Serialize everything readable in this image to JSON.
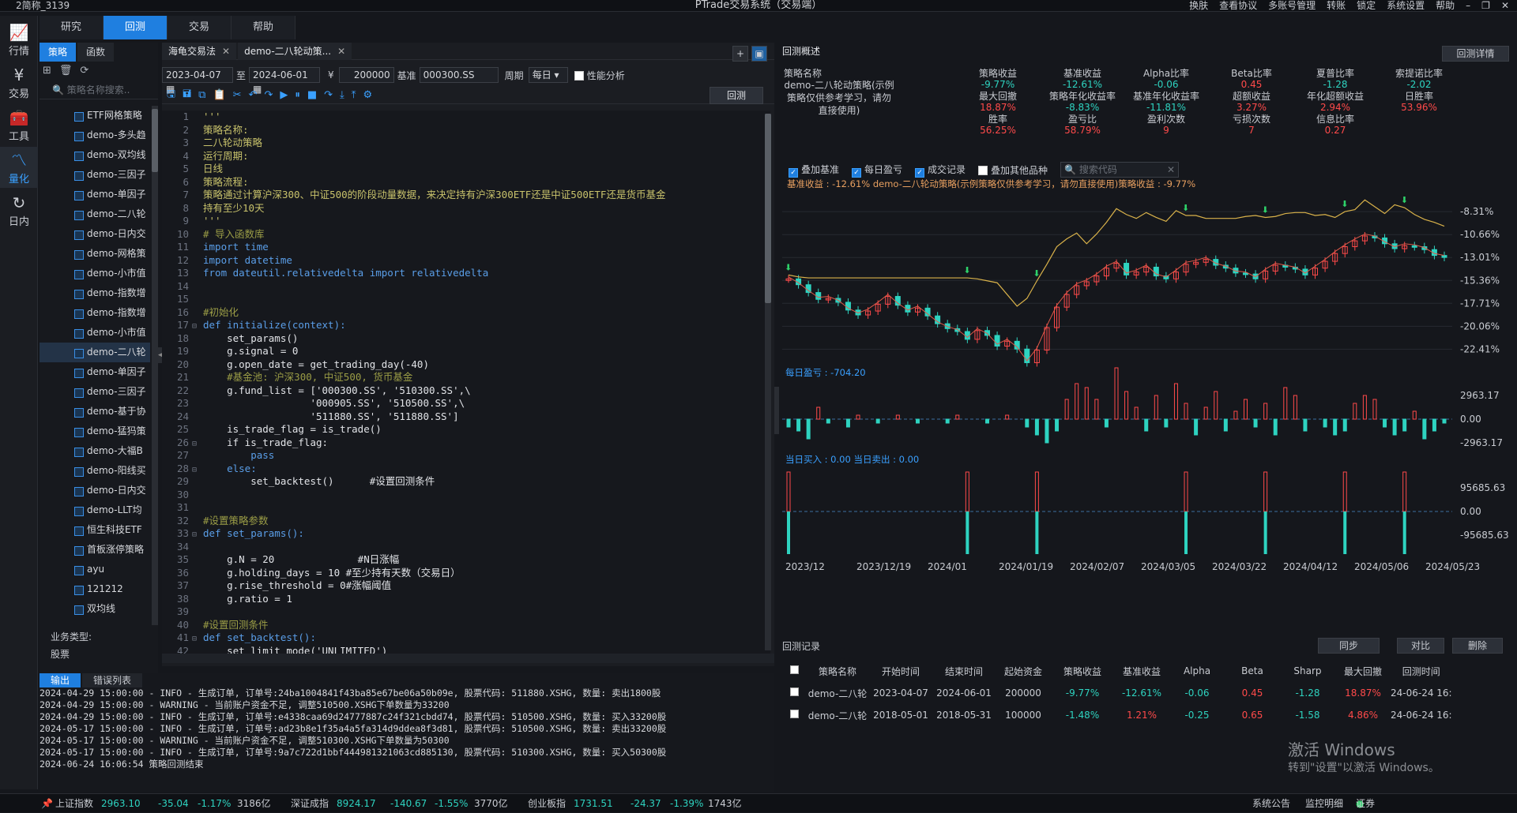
{
  "titlebar": {
    "user": "2简称_3139",
    "app": "PTrade交易系统（交易端）",
    "tools": [
      "换肤",
      "查看协议",
      "多账号管理",
      "转账",
      "锁定",
      "系统设置",
      "帮助"
    ]
  },
  "menu": [
    "研究",
    "回测",
    "交易",
    "帮助"
  ],
  "leftnav": [
    "行情",
    "交易",
    "工具",
    "量化",
    "日内"
  ],
  "strategy": {
    "tabs": [
      "策略",
      "函数"
    ],
    "search_placeholder": "策略名称搜索..",
    "items": [
      "ETF网格策略",
      "demo-多头趋",
      "demo-双均线",
      "demo-三因子",
      "demo-单因子",
      "demo-二八轮",
      "demo-日内交",
      "demo-网格策",
      "demo-小市值",
      "demo-指数增",
      "demo-指数增",
      "demo-小市值",
      "demo-二八轮",
      "demo-单因子",
      "demo-三因子",
      "demo-基于协",
      "demo-猛犸策",
      "demo-大福B",
      "demo-阳线买",
      "demo-日内交",
      "demo-LLT均",
      "恒生科技ETF",
      "首板涨停策略",
      "ayu",
      "121212",
      "双均线"
    ],
    "selected_index": 12,
    "biz_label": "业务类型:",
    "biz_value": "股票"
  },
  "editor": {
    "tabs": [
      "海龟交易法",
      "demo-二八轮动策..."
    ],
    "start": "2023-04-07",
    "to": "至",
    "end": "2024-06-01",
    "currency": "¥",
    "capital": "200000",
    "bench_label": "基准",
    "bench": "000300.SS",
    "period_label": "周期",
    "period": "每日",
    "perf": "性能分析",
    "backtest_btn": "回测"
  },
  "code": [
    [
      "1",
      "",
      "'''",
      "c"
    ],
    [
      "2",
      "",
      "策略名称:",
      "c"
    ],
    [
      "3",
      "",
      "二八轮动策略",
      "c"
    ],
    [
      "4",
      "",
      "运行周期:",
      "c"
    ],
    [
      "5",
      "",
      "日线",
      "c"
    ],
    [
      "6",
      "",
      "策略流程:",
      "c"
    ],
    [
      "7",
      "",
      "策略通过计算沪深300、中证500的阶段动量数据，来决定持有沪深300ETF还是中证500ETF还是货币基金",
      "c"
    ],
    [
      "8",
      "",
      "持有至少10天",
      "c"
    ],
    [
      "9",
      "",
      "'''",
      "c"
    ],
    [
      "10",
      "",
      "# 导入函数库",
      "cm"
    ],
    [
      "11",
      "",
      "import time",
      "k"
    ],
    [
      "12",
      "",
      "import datetime",
      "k"
    ],
    [
      "13",
      "",
      "from dateutil.relativedelta import relativedelta",
      "k"
    ],
    [
      "14",
      "",
      "",
      "d"
    ],
    [
      "15",
      "",
      "",
      "d"
    ],
    [
      "16",
      "",
      "#初始化",
      "cm"
    ],
    [
      "17",
      "⊟",
      "def initialize(context):",
      "k"
    ],
    [
      "18",
      "",
      "    set_params()",
      "d"
    ],
    [
      "19",
      "",
      "    g.signal = 0",
      "d"
    ],
    [
      "20",
      "",
      "    g.open_date = get_trading_day(-40)",
      "d"
    ],
    [
      "21",
      "",
      "    #基金池: 沪深300, 中证500, 货币基金",
      "cm"
    ],
    [
      "22",
      "",
      "    g.fund_list = ['000300.SS', '510300.SS',\\",
      "d"
    ],
    [
      "23",
      "",
      "                  '000905.SS', '510500.SS',\\",
      "d"
    ],
    [
      "24",
      "",
      "                  '511880.SS', '511880.SS']",
      "d"
    ],
    [
      "25",
      "",
      "    is_trade_flag = is_trade()",
      "d"
    ],
    [
      "26",
      "⊟",
      "    if is_trade_flag:",
      "d"
    ],
    [
      "27",
      "",
      "        pass",
      "k"
    ],
    [
      "28",
      "⊟",
      "    else:",
      "k"
    ],
    [
      "29",
      "",
      "        set_backtest()      #设置回测条件",
      "d"
    ],
    [
      "30",
      "",
      "",
      "d"
    ],
    [
      "31",
      "",
      "",
      "d"
    ],
    [
      "32",
      "",
      "#设置策略参数",
      "cm"
    ],
    [
      "33",
      "⊟",
      "def set_params():",
      "k"
    ],
    [
      "34",
      "",
      "",
      "d"
    ],
    [
      "35",
      "",
      "    g.N = 20              #N日涨幅",
      "d"
    ],
    [
      "36",
      "",
      "    g.holding_days = 10 #至少持有天数（交易日）",
      "d"
    ],
    [
      "37",
      "",
      "    g.rise_threshold = 0#涨幅阈值",
      "d"
    ],
    [
      "38",
      "",
      "    g.ratio = 1",
      "d"
    ],
    [
      "39",
      "",
      "",
      "d"
    ],
    [
      "40",
      "",
      "#设置回测条件",
      "cm"
    ],
    [
      "41",
      "⊟",
      "def set_backtest():",
      "k"
    ],
    [
      "42",
      "",
      "    set_limit_mode('UNLIMITED')",
      "d"
    ]
  ],
  "output": {
    "tabs": [
      "输出",
      "错误列表"
    ],
    "lines": [
      "2024-04-29 15:00:00 - INFO - 生成订单, 订单号:24ba1004841f43ba85e67be06a50b09e, 股票代码: 511880.XSHG, 数量: 卖出1800股",
      "2024-04-29 15:00:00 - WARNING - 当前账户资金不足, 调整510500.XSHG下单数量为33200",
      "2024-04-29 15:00:00 - INFO - 生成订单, 订单号:e4338caa69d24777887c24f321cbdd74, 股票代码: 510500.XSHG, 数量: 买入33200股",
      "2024-05-17 15:00:00 - INFO - 生成订单, 订单号:ad23b8e1f35a4a5fa314d9ddea8f3d81, 股票代码: 510500.XSHG, 数量: 卖出33200股",
      "2024-05-17 15:00:00 - WARNING - 当前账户资金不足, 调整510300.XSHG下单数量为50300",
      "2024-05-17 15:00:00 - INFO - 生成订单, 订单号:9a7c722d1bbf444981321063cd885130, 股票代码: 510300.XSHG, 数量: 买入50300股",
      "2024-06-24 16:06:54 策略回测结束"
    ]
  },
  "overview": {
    "title": "回测概述",
    "detail_btn": "回测详情",
    "name_label": "策略名称",
    "name_value": "demo-二八轮动策略(示例策略仅供参考学习，请勿直接使用)",
    "metrics": [
      {
        "l": "策略收益",
        "v": "-9.77%",
        "c": "green"
      },
      {
        "l": "基准收益",
        "v": "-12.61%",
        "c": "green"
      },
      {
        "l": "Alpha比率",
        "v": "-0.06",
        "c": "green"
      },
      {
        "l": "Beta比率",
        "v": "0.45",
        "c": "red"
      },
      {
        "l": "夏普比率",
        "v": "-1.28",
        "c": "green"
      },
      {
        "l": "索提诺比率",
        "v": "-2.02",
        "c": "green"
      },
      {
        "l": "最大回撤",
        "v": "18.87%",
        "c": "red"
      },
      {
        "l": "策略年化收益率",
        "v": "-8.83%",
        "c": "green"
      },
      {
        "l": "基准年化收益率",
        "v": "-11.81%",
        "c": "green"
      },
      {
        "l": "超额收益",
        "v": "3.27%",
        "c": "red"
      },
      {
        "l": "年化超额收益",
        "v": "2.94%",
        "c": "red"
      },
      {
        "l": "日胜率",
        "v": "53.96%",
        "c": "red"
      },
      {
        "l": "胜率",
        "v": "56.25%",
        "c": "red"
      },
      {
        "l": "盈亏比",
        "v": "58.79%",
        "c": "red"
      },
      {
        "l": "盈利次数",
        "v": "9",
        "c": "red"
      },
      {
        "l": "亏损次数",
        "v": "7",
        "c": "red"
      },
      {
        "l": "信息比率",
        "v": "0.27",
        "c": "red"
      }
    ],
    "checks": [
      "叠加基准",
      "每日盈亏",
      "成交记录",
      "叠加其他品种"
    ],
    "search_code": "搜索代码",
    "chart_label": "基准收益 : -12.61%  demo-二八轮动策略(示例策略仅供参考学习，请勿直接使用)策略收益 : -9.77%",
    "daily_pnl": "每日盈亏 : -704.20",
    "buysell": "当日买入 : 0.00  当日卖出 : 0.00"
  },
  "chart_data": {
    "type": "line",
    "y_ticks_main": [
      "-8.31%",
      "-10.66%",
      "-13.01%",
      "-15.36%",
      "-17.71%",
      "-20.06%",
      "-22.41%"
    ],
    "y_ticks_pnl": [
      "2963.17",
      "0.00",
      "-2963.17"
    ],
    "y_ticks_trade": [
      "95685.63",
      "0.00",
      "-95685.63"
    ],
    "x_ticks": [
      "2023/12",
      "2023/12/19",
      "2024/01",
      "2024/01/19",
      "2024/02/07",
      "2024/03/05",
      "2024/03/22",
      "2024/04/12",
      "2024/05/06",
      "2024/05/23"
    ],
    "series": [
      {
        "name": "基准收益",
        "values": [
          -15.2,
          -15.8,
          -16.6,
          -17.3,
          -17.2,
          -17.6,
          -18.4,
          -18.9,
          -18.5,
          -17.8,
          -17.0,
          -17.9,
          -18.6,
          -18.2,
          -19.0,
          -19.8,
          -20.3,
          -20.6,
          -21.4,
          -20.5,
          -21.0,
          -22.1,
          -21.6,
          -22.4,
          -23.8,
          -22.5,
          -20.2,
          -18.1,
          -16.8,
          -15.9,
          -15.5,
          -14.9,
          -14.1,
          -13.6,
          -14.8,
          -14.5,
          -14.0,
          -14.9,
          -15.2,
          -14.5,
          -13.7,
          -13.5,
          -13.2,
          -13.8,
          -14.1,
          -14.6,
          -14.7,
          -15.2,
          -14.4,
          -13.8,
          -14.0,
          -14.2,
          -14.8,
          -14.1,
          -13.4,
          -12.6,
          -11.9,
          -11.3,
          -10.8,
          -11.0,
          -11.6,
          -12.1,
          -11.8,
          -11.9,
          -12.2,
          -12.8,
          -13.0
        ]
      },
      {
        "name": "策略收益",
        "values": [
          -14.8,
          -15.0,
          -15.1,
          -15.1,
          -15.1,
          -15.1,
          -15.1,
          -15.1,
          -15.1,
          -15.1,
          -15.1,
          -15.1,
          -15.1,
          -15.1,
          -15.1,
          -15.1,
          -15.1,
          -15.1,
          -15.1,
          -15.2,
          -15.4,
          -15.6,
          -16.8,
          -18.0,
          -17.2,
          -15.4,
          -13.7,
          -11.9,
          -11.1,
          -10.5,
          -11.6,
          -10.6,
          -9.4,
          -8.0,
          -8.6,
          -9.0,
          -8.4,
          -8.9,
          -9.3,
          -8.2,
          -8.7,
          -8.7,
          -9.0,
          -9.0,
          -9.0,
          -9.0,
          -8.8,
          -8.7,
          -8.9,
          -8.8,
          -8.5,
          -8.4,
          -8.4,
          -8.7,
          -8.6,
          -8.9,
          -8.3,
          -8.1,
          -7.1,
          -7.8,
          -8.5,
          -7.6,
          -7.9,
          -8.6,
          -9.1,
          -9.4,
          -9.8
        ]
      }
    ]
  },
  "records": {
    "title": "回测记录",
    "btns": [
      "同步",
      "对比",
      "删除"
    ],
    "headers": [
      "策略名称",
      "开始时间",
      "结束时间",
      "起始资金",
      "策略收益",
      "基准收益",
      "Alpha",
      "Beta",
      "Sharp",
      "最大回撤",
      "回测时间"
    ],
    "rows": [
      [
        "demo-二八轮",
        "2023-04-07",
        "2024-06-01",
        "200000",
        "-9.77%",
        "-12.61%",
        "-0.06",
        "0.45",
        "-1.28",
        "18.87%",
        "24-06-24 16:"
      ],
      [
        "demo-二八轮",
        "2018-05-01",
        "2018-05-31",
        "100000",
        "-1.48%",
        "1.21%",
        "-0.25",
        "0.65",
        "-1.58",
        "4.86%",
        "24-06-24 16:"
      ]
    ]
  },
  "statusbar": {
    "sh": "上证指数",
    "sh_v": "2963.10",
    "sh_c": "-35.04",
    "sh_p": "-1.17%",
    "sh_a": "3186亿",
    "sz": "深证成指",
    "sz_v": "8924.17",
    "sz_c": "-140.67",
    "sz_p": "-1.55%",
    "sz_a": "3770亿",
    "cy": "创业板指",
    "cy_v": "1731.51",
    "cy_c": "-24.37",
    "cy_p": "-1.39%",
    "cy_a": "1743亿",
    "notice": "系统公告",
    "monitor": "监控明细",
    "sec": "证券"
  },
  "watermark": {
    "line1": "激活 Windows",
    "line2": "转到\"设置\"以激活 Windows。"
  }
}
